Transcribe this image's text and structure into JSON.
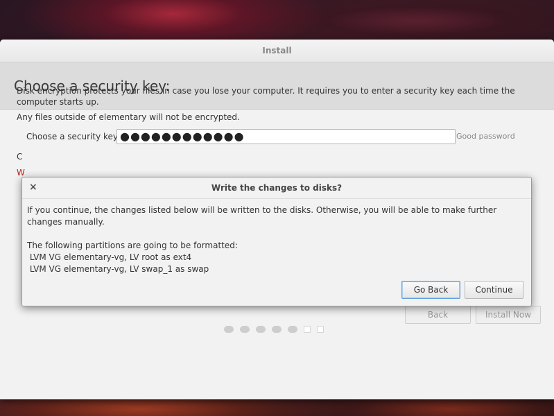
{
  "window": {
    "title": "Install"
  },
  "header": {
    "title": "Choose a security key:"
  },
  "content": {
    "description": "Disk encryption protects your files in case you lose your computer. It requires you to enter a security key each time the computer starts up.",
    "note": "Any files outside of elementary will not be encrypted.",
    "key_label": "Choose a security key:",
    "key_value": "●●●●●●●●●●●●",
    "key_link": "Good password",
    "confirm_label": "C",
    "warning_text": "W"
  },
  "footer": {
    "back_label": "Back",
    "install_label": "Install Now"
  },
  "progress": {
    "total_steps": 7,
    "current_step": 6
  },
  "dialog": {
    "title": "Write the changes to disks?",
    "close_icon": "×",
    "message": "If you continue, the changes listed below will be written to the disks. Otherwise, you will be able to make further changes manually.",
    "partitions_heading": "The following partitions are going to be formatted:",
    "partitions": [
      " LVM VG elementary-vg, LV root as ext4",
      " LVM VG elementary-vg, LV swap_1 as swap"
    ],
    "go_back_label": "Go Back",
    "continue_label": "Continue"
  }
}
